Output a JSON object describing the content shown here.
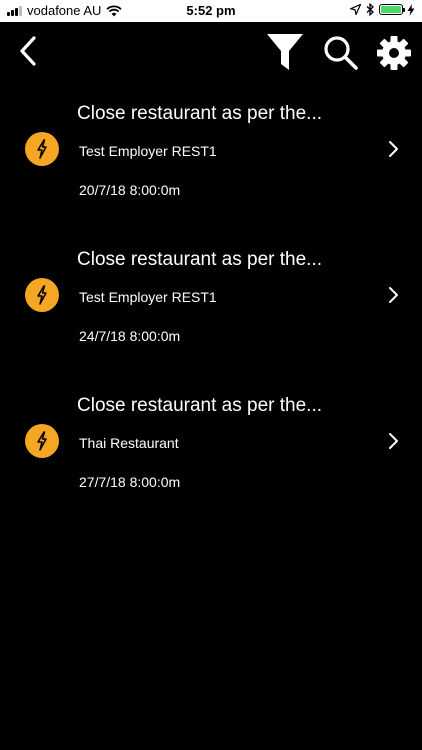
{
  "status_bar": {
    "carrier": "vodafone AU",
    "time": "5:52 pm",
    "battery_level": 1.0,
    "battery_color": "#4cd964"
  },
  "nav": {
    "back_icon": "chevron-left-icon",
    "filter_icon": "filter-icon",
    "search_icon": "search-icon",
    "settings_icon": "gear-icon"
  },
  "colors": {
    "background": "#000000",
    "accent_badge": "#f5a623",
    "text": "#ffffff"
  },
  "items": [
    {
      "title": "Close restaurant as per the...",
      "employer": "Test Employer REST1",
      "date": "20/7/18 8:00:0m",
      "icon": "lightning-icon"
    },
    {
      "title": "Close restaurant as per the...",
      "employer": "Test Employer REST1",
      "date": "24/7/18 8:00:0m",
      "icon": "lightning-icon"
    },
    {
      "title": "Close restaurant as per the...",
      "employer": "Thai Restaurant",
      "date": "27/7/18 8:00:0m",
      "icon": "lightning-icon"
    }
  ]
}
